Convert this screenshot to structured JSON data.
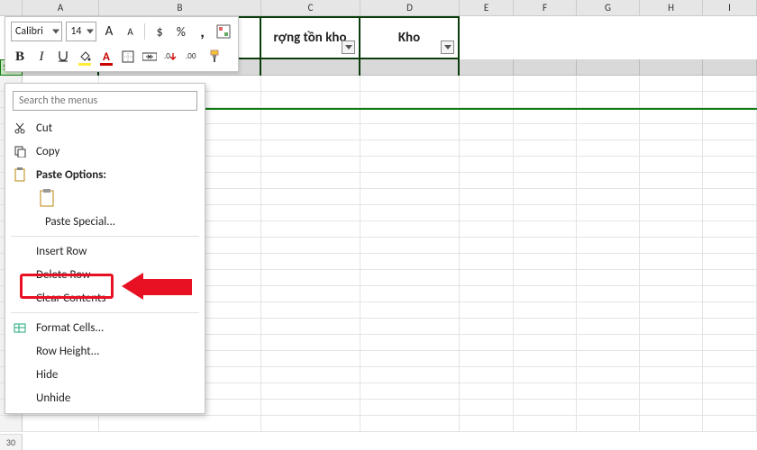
{
  "columns": [
    "A",
    "B",
    "C",
    "D",
    "E",
    "F",
    "G",
    "H",
    "I"
  ],
  "col_widths": [
    "wA",
    "wB",
    "wC",
    "wD",
    "wE",
    "wF",
    "wG",
    "wH",
    "wI"
  ],
  "table_headers": {
    "c": "rợng tồn kho",
    "d": "Kho"
  },
  "selected_row_label": "5",
  "last_row_label": "30",
  "mini_toolbar": {
    "font_name": "Calibri",
    "font_size": "14",
    "increase_font": "A",
    "decrease_font": "A",
    "currency": "$",
    "percent": "%",
    "comma": ",",
    "bold": "B",
    "italic": "I"
  },
  "context_menu": {
    "search_placeholder": "Search the menus",
    "cut": "Cut",
    "copy": "Copy",
    "paste_options": "Paste Options:",
    "paste_special": "Paste Special...",
    "insert_row": "Insert Row",
    "delete_row": "Delete Row",
    "clear_contents": "Clear Contents",
    "format_cells": "Format Cells...",
    "row_height": "Row Height...",
    "hide": "Hide",
    "unhide": "Unhide"
  }
}
